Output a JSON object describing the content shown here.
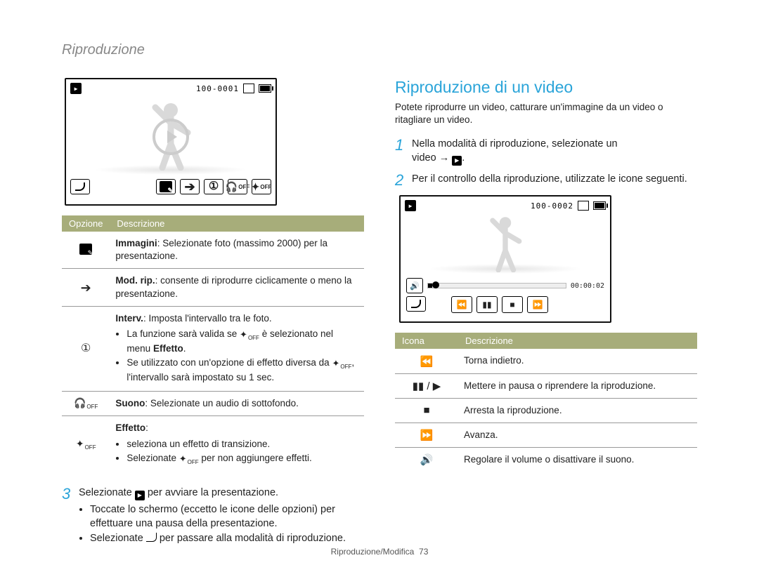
{
  "header": "Riproduzione",
  "footer": {
    "text": "Riproduzione/Modifica",
    "page": "73"
  },
  "left": {
    "screen_counter": "100-0001",
    "table": {
      "head": [
        "Opzione",
        "Descrizione"
      ],
      "rows": [
        {
          "icon": "card-pencil",
          "html": "<b>Immagini</b>: Selezionate foto (massimo 2000) per la presentazione."
        },
        {
          "icon": "arrow-right",
          "html": "<b>Mod. rip.</b>: consente di riprodurre ciclicamente o meno la presentazione."
        },
        {
          "icon": "clock",
          "html": "<b>Interv.</b>: Imposta l'intervallo tra le foto.",
          "bullets": [
            "La funzione sarà valida se <span class='inlinespark'>✦<span class='offsub'>OFF</span></span> è selezionato nel menu <b>Effetto</b>.",
            "Se utilizzato con un'opzione di effetto diversa da <span class='inlinespark'>✦<span class='offsub'>OFF</span></span>, l'intervallo sarà impostato su 1 sec."
          ]
        },
        {
          "icon": "headphones",
          "html": "<b>Suono</b>: Selezionate un audio di sottofondo."
        },
        {
          "icon": "sparkle-off",
          "html": "<b>Effetto</b>:",
          "bullets": [
            "seleziona un effetto di transizione.",
            "Selezionate <span class='inlinespark'>✦<span class='offsub'>OFF</span></span> per non aggiungere effetti."
          ]
        }
      ]
    },
    "step3": {
      "num": "3",
      "text_before": "Selezionate ",
      "text_after": " per avviare la presentazione.",
      "bullets": [
        "Toccate lo schermo (eccetto le icone delle opzioni) per effettuare una pausa della presentazione.",
        "Selezionate <span class='inlineback'></span> per passare alla modalità di riproduzione."
      ]
    }
  },
  "right": {
    "title": "Riproduzione di un video",
    "intro": "Potete riprodurre un video, catturare un'immagine da un video o ritagliare un video.",
    "step1": {
      "num": "1",
      "line1": "Nella modalità di riproduzione, selezionate un",
      "line2_before": "video → ",
      "line2_after": "."
    },
    "step2": {
      "num": "2",
      "text": "Per il controllo della riproduzione, utilizzate le icone seguenti."
    },
    "screen": {
      "counter": "100-0002",
      "time": "00:00:02"
    },
    "table": {
      "head": [
        "Icona",
        "Descrizione"
      ],
      "rows": [
        {
          "icon": "⏪",
          "text": "Torna indietro."
        },
        {
          "icon": "▮▮ / ▶",
          "text": "Mettere in pausa o riprendere la riproduzione."
        },
        {
          "icon": "■",
          "text": "Arresta la riproduzione."
        },
        {
          "icon": "⏩",
          "text": "Avanza."
        },
        {
          "icon": "🔊",
          "text": "Regolare il volume o disattivare il suono."
        }
      ]
    }
  }
}
